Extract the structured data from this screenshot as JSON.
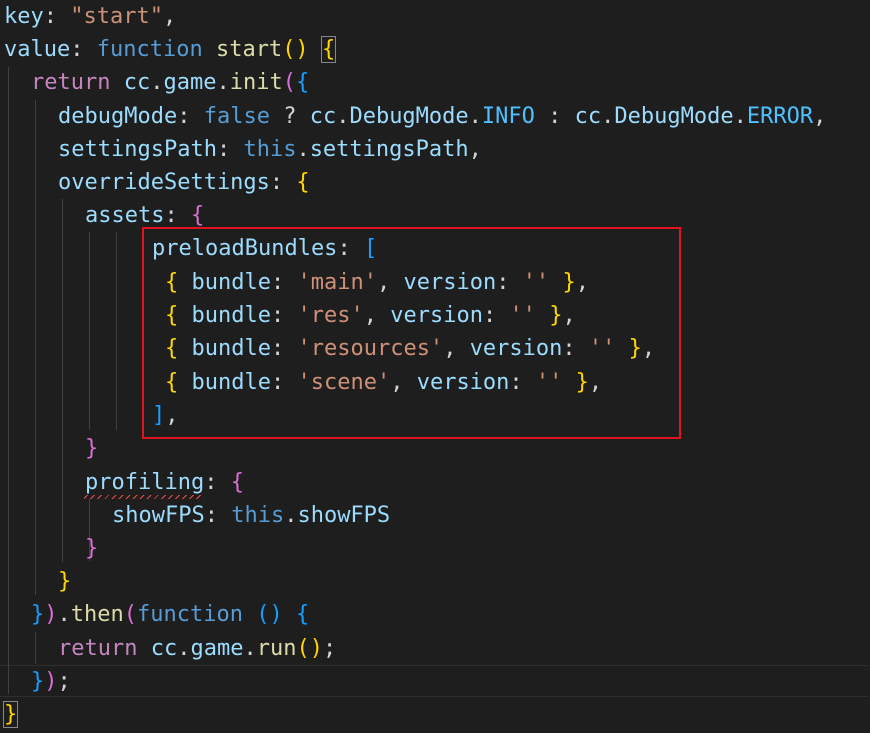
{
  "editor": {
    "lines": [
      {
        "k": "key",
        "colon": ": ",
        "str": "\"start\"",
        "comma": ","
      },
      {
        "k": "value",
        "colon": ": ",
        "fn_kw": "function",
        "fn_name": "start",
        "paren": "()",
        "brace": "{"
      },
      {
        "ret": "return",
        "obj": "cc",
        "dot1": ".",
        "game": "game",
        "dot2": ".",
        "init": "init",
        "paren": "(",
        "brace": "{"
      },
      {
        "k": "debugMode",
        "colon": ": ",
        "bool": "false",
        "q": " ? ",
        "obj": "cc",
        "dot": ".",
        "cls": "DebugMode",
        "dot2": ".",
        "const1": "INFO",
        "colon2": " : ",
        "obj2": "cc",
        "dot3": ".",
        "cls2": "DebugMode",
        "dot4": ".",
        "const2": "ERROR",
        "comma": ","
      },
      {
        "k": "settingsPath",
        "colon": ": ",
        "this": "this",
        "dot": ".",
        "prop": "settingsPath",
        "comma": ","
      },
      {
        "k": "overrideSettings",
        "colon": ": ",
        "brace": "{"
      },
      {
        "k": "assets",
        "colon": ": ",
        "brace": "{"
      },
      {
        "k": "preloadBundles",
        "colon": ": ",
        "bracket": "["
      },
      {
        "open": "{",
        "k1": "bundle",
        "c1": ": ",
        "s1": "'main'",
        "sep": ", ",
        "k2": "version",
        "c2": ": ",
        "s2": "''",
        "close": "}",
        "comma": ","
      },
      {
        "open": "{",
        "k1": "bundle",
        "c1": ": ",
        "s1": "'res'",
        "sep": ", ",
        "k2": "version",
        "c2": ": ",
        "s2": "''",
        "close": "}",
        "comma": ","
      },
      {
        "open": "{",
        "k1": "bundle",
        "c1": ": ",
        "s1": "'resources'",
        "sep": ", ",
        "k2": "version",
        "c2": ": ",
        "s2": "''",
        "close": "}",
        "comma": ","
      },
      {
        "open": "{",
        "k1": "bundle",
        "c1": ": ",
        "s1": "'scene'",
        "sep": ", ",
        "k2": "version",
        "c2": ": ",
        "s2": "''",
        "close": "}",
        "comma": ","
      },
      {
        "bracket": "]",
        "comma": ","
      },
      {
        "brace": "}"
      },
      {
        "k": "profiling",
        "colon": ": ",
        "brace": "{"
      },
      {
        "k": "showFPS",
        "colon": ": ",
        "this": "this",
        "dot": ".",
        "prop": "showFPS"
      },
      {
        "brace": "}"
      },
      {
        "brace": "}"
      },
      {
        "brace": "}",
        "paren": ")",
        "dot": ".",
        "then": "then",
        "paren2": "(",
        "fn_kw": "function",
        "sp": " ",
        "args": "()",
        "brace2": "{"
      },
      {
        "ret": "return",
        "obj": "cc",
        "dot1": ".",
        "game": "game",
        "dot2": ".",
        "run": "run",
        "parens": "()",
        "semi": ";"
      },
      {
        "brace": "}",
        "paren": ")",
        "semi": ";"
      },
      {
        "brace": "}"
      }
    ]
  },
  "colors": {
    "background": "#1e1e1e",
    "highlight_box": "#e0141e",
    "property": "#9cdcfe",
    "string": "#ce9178",
    "keyword": "#569cd6",
    "control": "#c586c0",
    "function": "#dcdcaa"
  }
}
